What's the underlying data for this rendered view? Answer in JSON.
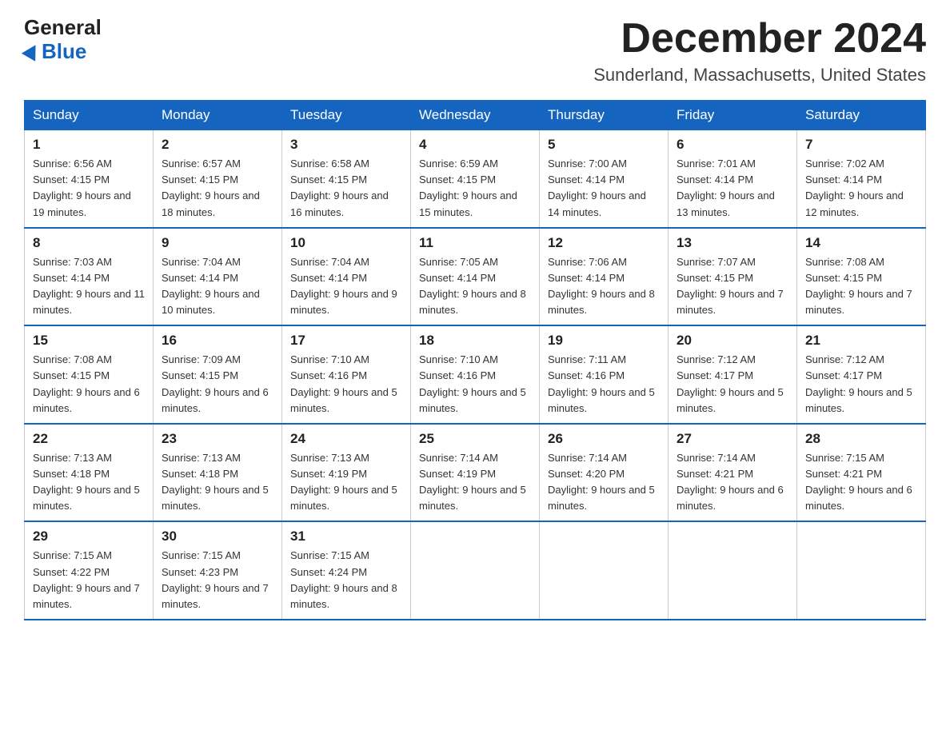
{
  "header": {
    "logo_general": "General",
    "logo_blue": "Blue",
    "month_title": "December 2024",
    "location": "Sunderland, Massachusetts, United States"
  },
  "weekdays": [
    "Sunday",
    "Monday",
    "Tuesday",
    "Wednesday",
    "Thursday",
    "Friday",
    "Saturday"
  ],
  "weeks": [
    [
      {
        "day": "1",
        "sunrise": "6:56 AM",
        "sunset": "4:15 PM",
        "daylight": "9 hours and 19 minutes."
      },
      {
        "day": "2",
        "sunrise": "6:57 AM",
        "sunset": "4:15 PM",
        "daylight": "9 hours and 18 minutes."
      },
      {
        "day": "3",
        "sunrise": "6:58 AM",
        "sunset": "4:15 PM",
        "daylight": "9 hours and 16 minutes."
      },
      {
        "day": "4",
        "sunrise": "6:59 AM",
        "sunset": "4:15 PM",
        "daylight": "9 hours and 15 minutes."
      },
      {
        "day": "5",
        "sunrise": "7:00 AM",
        "sunset": "4:14 PM",
        "daylight": "9 hours and 14 minutes."
      },
      {
        "day": "6",
        "sunrise": "7:01 AM",
        "sunset": "4:14 PM",
        "daylight": "9 hours and 13 minutes."
      },
      {
        "day": "7",
        "sunrise": "7:02 AM",
        "sunset": "4:14 PM",
        "daylight": "9 hours and 12 minutes."
      }
    ],
    [
      {
        "day": "8",
        "sunrise": "7:03 AM",
        "sunset": "4:14 PM",
        "daylight": "9 hours and 11 minutes."
      },
      {
        "day": "9",
        "sunrise": "7:04 AM",
        "sunset": "4:14 PM",
        "daylight": "9 hours and 10 minutes."
      },
      {
        "day": "10",
        "sunrise": "7:04 AM",
        "sunset": "4:14 PM",
        "daylight": "9 hours and 9 minutes."
      },
      {
        "day": "11",
        "sunrise": "7:05 AM",
        "sunset": "4:14 PM",
        "daylight": "9 hours and 8 minutes."
      },
      {
        "day": "12",
        "sunrise": "7:06 AM",
        "sunset": "4:14 PM",
        "daylight": "9 hours and 8 minutes."
      },
      {
        "day": "13",
        "sunrise": "7:07 AM",
        "sunset": "4:15 PM",
        "daylight": "9 hours and 7 minutes."
      },
      {
        "day": "14",
        "sunrise": "7:08 AM",
        "sunset": "4:15 PM",
        "daylight": "9 hours and 7 minutes."
      }
    ],
    [
      {
        "day": "15",
        "sunrise": "7:08 AM",
        "sunset": "4:15 PM",
        "daylight": "9 hours and 6 minutes."
      },
      {
        "day": "16",
        "sunrise": "7:09 AM",
        "sunset": "4:15 PM",
        "daylight": "9 hours and 6 minutes."
      },
      {
        "day": "17",
        "sunrise": "7:10 AM",
        "sunset": "4:16 PM",
        "daylight": "9 hours and 5 minutes."
      },
      {
        "day": "18",
        "sunrise": "7:10 AM",
        "sunset": "4:16 PM",
        "daylight": "9 hours and 5 minutes."
      },
      {
        "day": "19",
        "sunrise": "7:11 AM",
        "sunset": "4:16 PM",
        "daylight": "9 hours and 5 minutes."
      },
      {
        "day": "20",
        "sunrise": "7:12 AM",
        "sunset": "4:17 PM",
        "daylight": "9 hours and 5 minutes."
      },
      {
        "day": "21",
        "sunrise": "7:12 AM",
        "sunset": "4:17 PM",
        "daylight": "9 hours and 5 minutes."
      }
    ],
    [
      {
        "day": "22",
        "sunrise": "7:13 AM",
        "sunset": "4:18 PM",
        "daylight": "9 hours and 5 minutes."
      },
      {
        "day": "23",
        "sunrise": "7:13 AM",
        "sunset": "4:18 PM",
        "daylight": "9 hours and 5 minutes."
      },
      {
        "day": "24",
        "sunrise": "7:13 AM",
        "sunset": "4:19 PM",
        "daylight": "9 hours and 5 minutes."
      },
      {
        "day": "25",
        "sunrise": "7:14 AM",
        "sunset": "4:19 PM",
        "daylight": "9 hours and 5 minutes."
      },
      {
        "day": "26",
        "sunrise": "7:14 AM",
        "sunset": "4:20 PM",
        "daylight": "9 hours and 5 minutes."
      },
      {
        "day": "27",
        "sunrise": "7:14 AM",
        "sunset": "4:21 PM",
        "daylight": "9 hours and 6 minutes."
      },
      {
        "day": "28",
        "sunrise": "7:15 AM",
        "sunset": "4:21 PM",
        "daylight": "9 hours and 6 minutes."
      }
    ],
    [
      {
        "day": "29",
        "sunrise": "7:15 AM",
        "sunset": "4:22 PM",
        "daylight": "9 hours and 7 minutes."
      },
      {
        "day": "30",
        "sunrise": "7:15 AM",
        "sunset": "4:23 PM",
        "daylight": "9 hours and 7 minutes."
      },
      {
        "day": "31",
        "sunrise": "7:15 AM",
        "sunset": "4:24 PM",
        "daylight": "9 hours and 8 minutes."
      },
      null,
      null,
      null,
      null
    ]
  ]
}
